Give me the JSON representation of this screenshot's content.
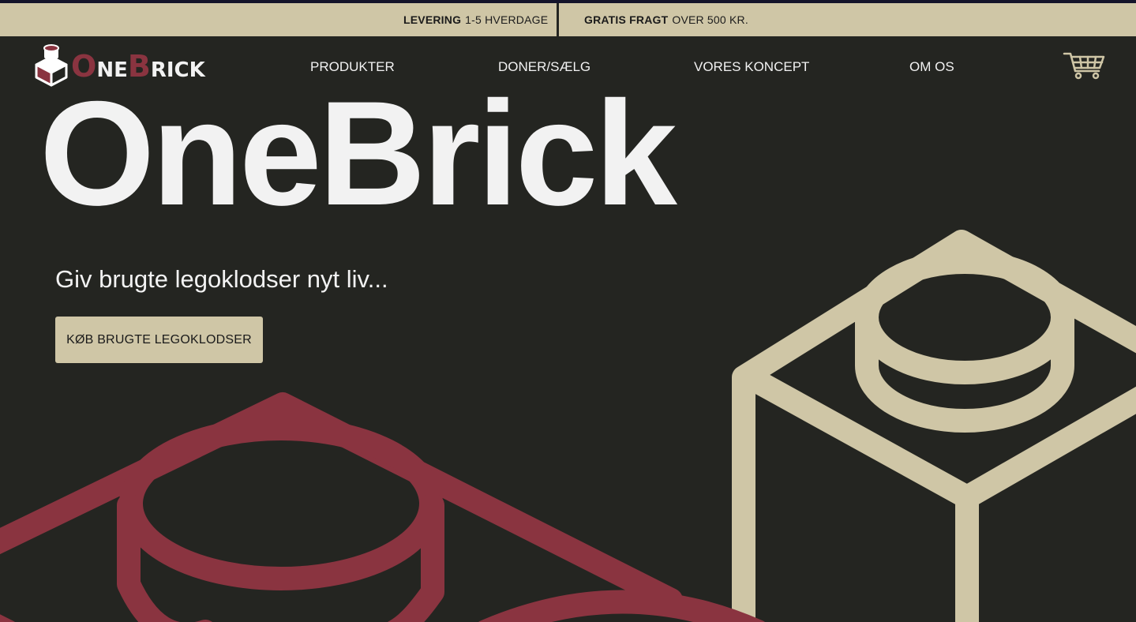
{
  "colors": {
    "background": "#242521",
    "accent_beige": "#cfc6a6",
    "accent_red": "#8a3440",
    "text_light": "#f2f2f2"
  },
  "topbar": {
    "delivery": {
      "label": "LEVERING",
      "value": "1-5 HVERDAGE"
    },
    "shipping": {
      "label": "GRATIS FRAGT",
      "value": "OVER 500 KR."
    }
  },
  "logo": {
    "letters": [
      {
        "text": "O",
        "color": "#8a3440",
        "size": "big"
      },
      {
        "text": "NE",
        "color": "#f2f2f2",
        "size": "small"
      },
      {
        "text": "B",
        "color": "#8a3440",
        "size": "big"
      },
      {
        "text": "RICK",
        "color": "#f2f2f2",
        "size": "small"
      }
    ]
  },
  "nav": {
    "items": [
      {
        "label": "PRODUKTER"
      },
      {
        "label": "DONER/SÆLG"
      },
      {
        "label": "VORES KONCEPT"
      },
      {
        "label": "OM OS"
      }
    ],
    "cart_icon": "shopping-cart-icon"
  },
  "hero": {
    "title": "OneBrick",
    "tagline": "Giv brugte legoklodser nyt liv...",
    "cta_label": "KØB BRUGTE LEGOKLODSER"
  },
  "decorations": [
    "lego-brick-outline-red",
    "lego-brick-outline-beige"
  ]
}
